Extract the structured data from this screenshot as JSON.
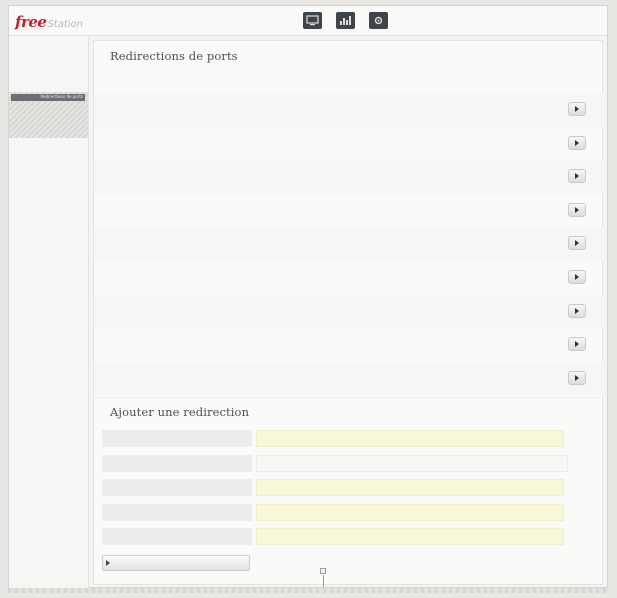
{
  "app": {
    "logo_main": "free",
    "logo_sub": "Station"
  },
  "toolbar": {
    "icons": [
      "monitor-icon",
      "chart-icon",
      "settings-icon"
    ]
  },
  "sidebar": {
    "items_top": [
      "",
      "",
      "",
      "",
      ""
    ],
    "active": {
      "title": "Redirections de ports",
      "subs": [
        "",
        "",
        ""
      ]
    },
    "items_bottom": [
      "",
      "",
      "",
      "",
      "",
      "",
      "",
      ""
    ]
  },
  "redirections": {
    "title": "Redirections de ports",
    "columns": [
      "",
      "",
      "",
      "",
      "",
      ""
    ],
    "rows": [
      {
        "c1": "",
        "c2": "",
        "c3": "",
        "c4": ""
      },
      {
        "c1": "",
        "c2": "",
        "c3": "",
        "c4": ""
      },
      {
        "c1": "",
        "c2": "",
        "c3": "",
        "c4": ""
      },
      {
        "c1": "",
        "c2": "",
        "c3": "",
        "c4": ""
      },
      {
        "c1": "",
        "c2": "",
        "c3": "",
        "c4": ""
      },
      {
        "c1": "",
        "c2": "",
        "c3": "",
        "c4": ""
      },
      {
        "c1": "",
        "c2": "",
        "c3": "",
        "c4": ""
      },
      {
        "c1": "",
        "c2": "",
        "c3": "",
        "c4": ""
      },
      {
        "c1": "",
        "c2": "",
        "c3": "",
        "c4": ""
      }
    ]
  },
  "add_form": {
    "title": "Ajouter une redirection",
    "fields": [
      {
        "label": "",
        "value": ""
      },
      {
        "label": "",
        "value": ""
      },
      {
        "label": "",
        "value": ""
      },
      {
        "label": "",
        "value": ""
      },
      {
        "label": "",
        "value": ""
      }
    ],
    "submit_label": ""
  },
  "colors": {
    "accent": "#c8202a",
    "input_bg": "#f8f7d8",
    "toolbar_icon": "#3e4448"
  }
}
